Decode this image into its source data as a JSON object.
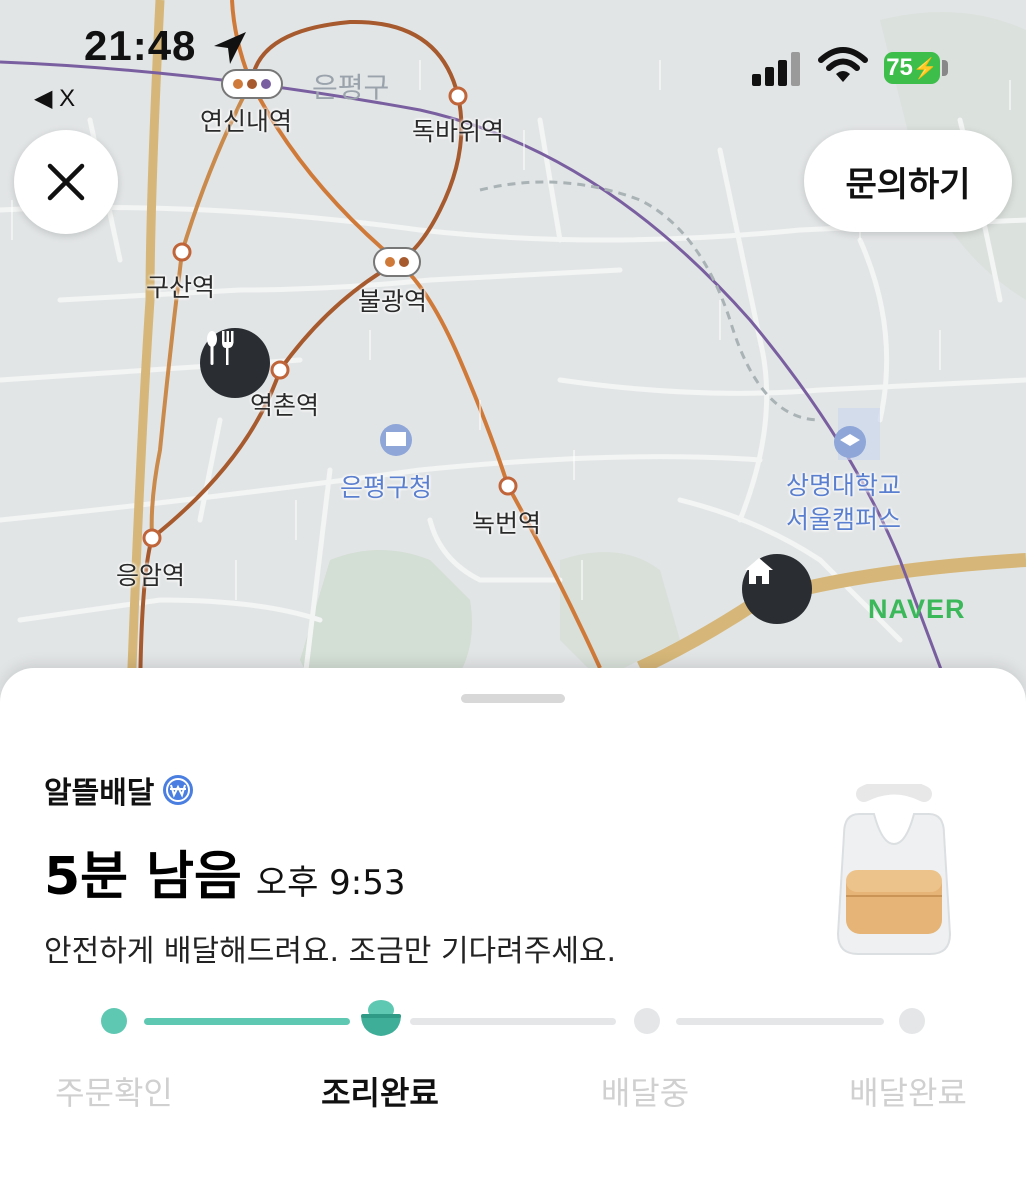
{
  "status_bar": {
    "time": "21:48",
    "back_app": "◀ X",
    "battery": "75"
  },
  "header": {
    "close_icon": "close-icon",
    "inquiry_label": "문의하기"
  },
  "map": {
    "district_label": "은평구",
    "stations": [
      "연신내역",
      "독바위역",
      "구산역",
      "불광역",
      "역촌역",
      "응암역",
      "녹번역"
    ],
    "landmarks": [
      "은평구청",
      "상명대학교",
      "서울캠퍼스"
    ],
    "provider": "NAVER",
    "pins": [
      "restaurant-icon",
      "home-icon"
    ],
    "colors": {
      "line3": "#d07a3a",
      "line6": "#a65a2e",
      "line_gyeongui": "#7a5fa0",
      "highway": "#d6b779",
      "background": "#e2e5e6"
    }
  },
  "order": {
    "shop_name": "알뜰배달",
    "shop_badge": "won-badge-icon",
    "remaining": "5분 남음",
    "eta": "오후 9:53",
    "message": "안전하게 배달해드려요. 조금만 기다려주세요."
  },
  "progress": {
    "accent": "#5fc8b2",
    "current_step": 1,
    "steps": [
      {
        "label": "주문확인"
      },
      {
        "label": "조리완료"
      },
      {
        "label": "배달중"
      },
      {
        "label": "배달완료"
      }
    ]
  }
}
